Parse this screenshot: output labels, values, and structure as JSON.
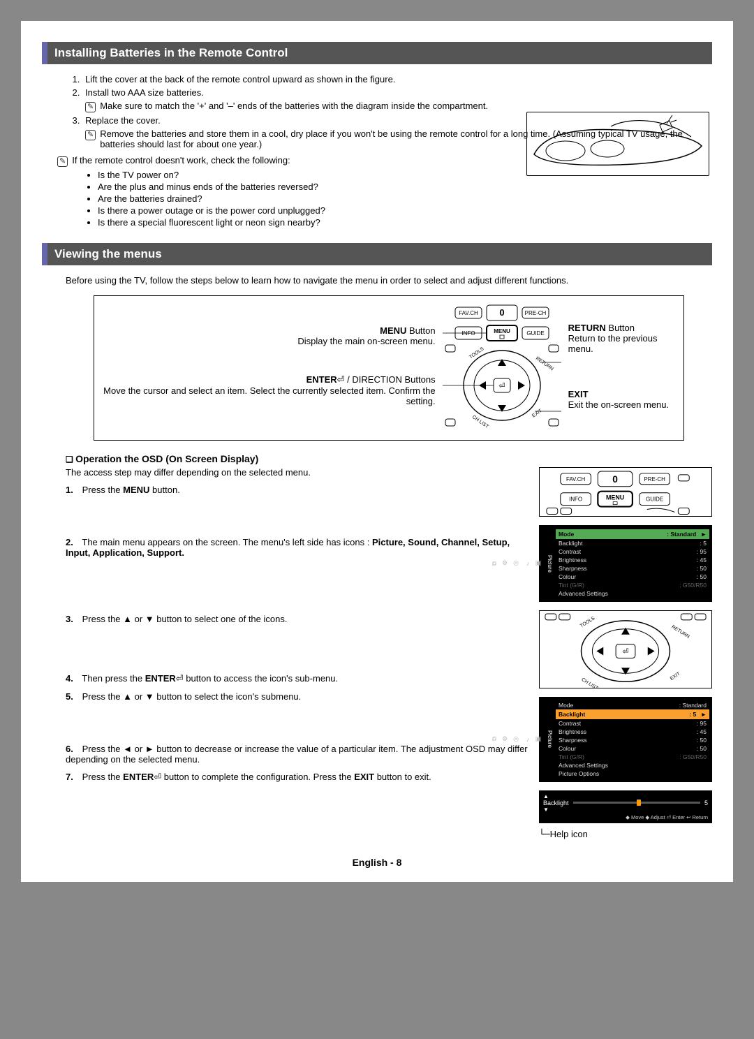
{
  "section1": {
    "heading": "Installing Batteries in the Remote Control",
    "steps": [
      "Lift the cover at the back of the remote control upward as shown in the figure.",
      "Install two AAA size batteries.",
      "Replace the cover."
    ],
    "note1": "Make sure to match the '+' and '–' ends of the batteries with the diagram inside the compartment.",
    "note2": "Remove the batteries and store them in a cool, dry place if you won't be using the remote control for a long time. (Assuming typical TV usage, the batteries should last for about one year.)",
    "check_intro": "If the remote control doesn't work, check the following:",
    "checks": [
      "Is the TV power on?",
      "Are the plus and minus ends of the batteries reversed?",
      "Are the batteries drained?",
      "Is there a power outage or is the power cord unplugged?",
      "Is there a special fluorescent light or neon sign nearby?"
    ]
  },
  "section2": {
    "heading": "Viewing the menus",
    "intro": "Before using the TV, follow the steps below to learn how to navigate the menu in order to select and adjust different functions.",
    "left_labels": {
      "menu_title": "MENU",
      "menu_suffix": " Button",
      "menu_desc": "Display the main on-screen menu.",
      "enter_title": "ENTER",
      "enter_suffix": " / DIRECTION Buttons",
      "enter_desc1": "Move the cursor and select an item. Select the currently selected item. Confirm the setting."
    },
    "right_labels": {
      "return_title": "RETURN",
      "return_suffix": " Button",
      "return_desc": "Return to the previous menu.",
      "exit_title": "EXIT",
      "exit_desc": "Exit the on-screen menu."
    },
    "buttons": {
      "favch": "FAV.CH",
      "prech": "PRE-CH",
      "info": "INFO",
      "menu": "MENU",
      "guide": "GUIDE"
    }
  },
  "osd": {
    "heading": "Operation the OSD (On Screen Display)",
    "intro": "The access step may differ depending on the selected menu.",
    "step1_num": "1.",
    "step1": "Press the MENU button.",
    "step2_num": "2.",
    "step2_a": "The main menu appears on the screen. The menu's left side has icons : ",
    "step2_b": "Picture, Sound, Channel, Setup, Input, Application, Support.",
    "step3_num": "3.",
    "step3": "Press the ▲ or ▼ button to select one of the icons.",
    "step4_num": "4.",
    "step4_a": "Then press the ",
    "step4_b": "ENTER",
    "step4_c": " button to access the icon's sub-menu.",
    "step5_num": "5.",
    "step5": "Press the ▲ or ▼ button to select the icon's submenu.",
    "step6_num": "6.",
    "step6": "Press the ◄ or ► button to decrease or increase the value of a particular item. The adjustment OSD may differ depending on the selected menu.",
    "step7_num": "7.",
    "step7_a": "Press the ",
    "step7_b": "ENTER",
    "step7_c": " button to complete the configuration. Press the ",
    "step7_d": "EXIT",
    "step7_e": " button to exit."
  },
  "picture_menu": {
    "title": "Picture",
    "header_label": "Mode",
    "header_value": ": Standard",
    "rows": [
      {
        "label": "Backlight",
        "value": ": 5"
      },
      {
        "label": "Contrast",
        "value": ": 95"
      },
      {
        "label": "Brightness",
        "value": ": 45"
      },
      {
        "label": "Sharpness",
        "value": ": 50"
      },
      {
        "label": "Colour",
        "value": ": 50"
      }
    ],
    "dim_row": {
      "label": "Tint (G/R)",
      "value": ": G50/R50"
    },
    "adv": "Advanced Settings"
  },
  "picture_menu2": {
    "title": "Picture",
    "header_label": "Mode",
    "header_value": ": Standard",
    "highlight_label": "Backlight",
    "highlight_value": ": 5",
    "rows": [
      {
        "label": "Contrast",
        "value": ": 95"
      },
      {
        "label": "Brightness",
        "value": ": 45"
      },
      {
        "label": "Sharpness",
        "value": ": 50"
      },
      {
        "label": "Colour",
        "value": ": 50"
      }
    ],
    "dim_row": {
      "label": "Tint (G/R)",
      "value": ": G50/R50"
    },
    "extra": [
      "Advanced Settings",
      "Picture Options"
    ]
  },
  "adjust": {
    "label": "Backlight",
    "value": "5",
    "hints": "◆ Move   ◆ Adjust   ⏎ Enter   ↩ Return"
  },
  "help_icon": "Help icon",
  "footer": "English - 8"
}
